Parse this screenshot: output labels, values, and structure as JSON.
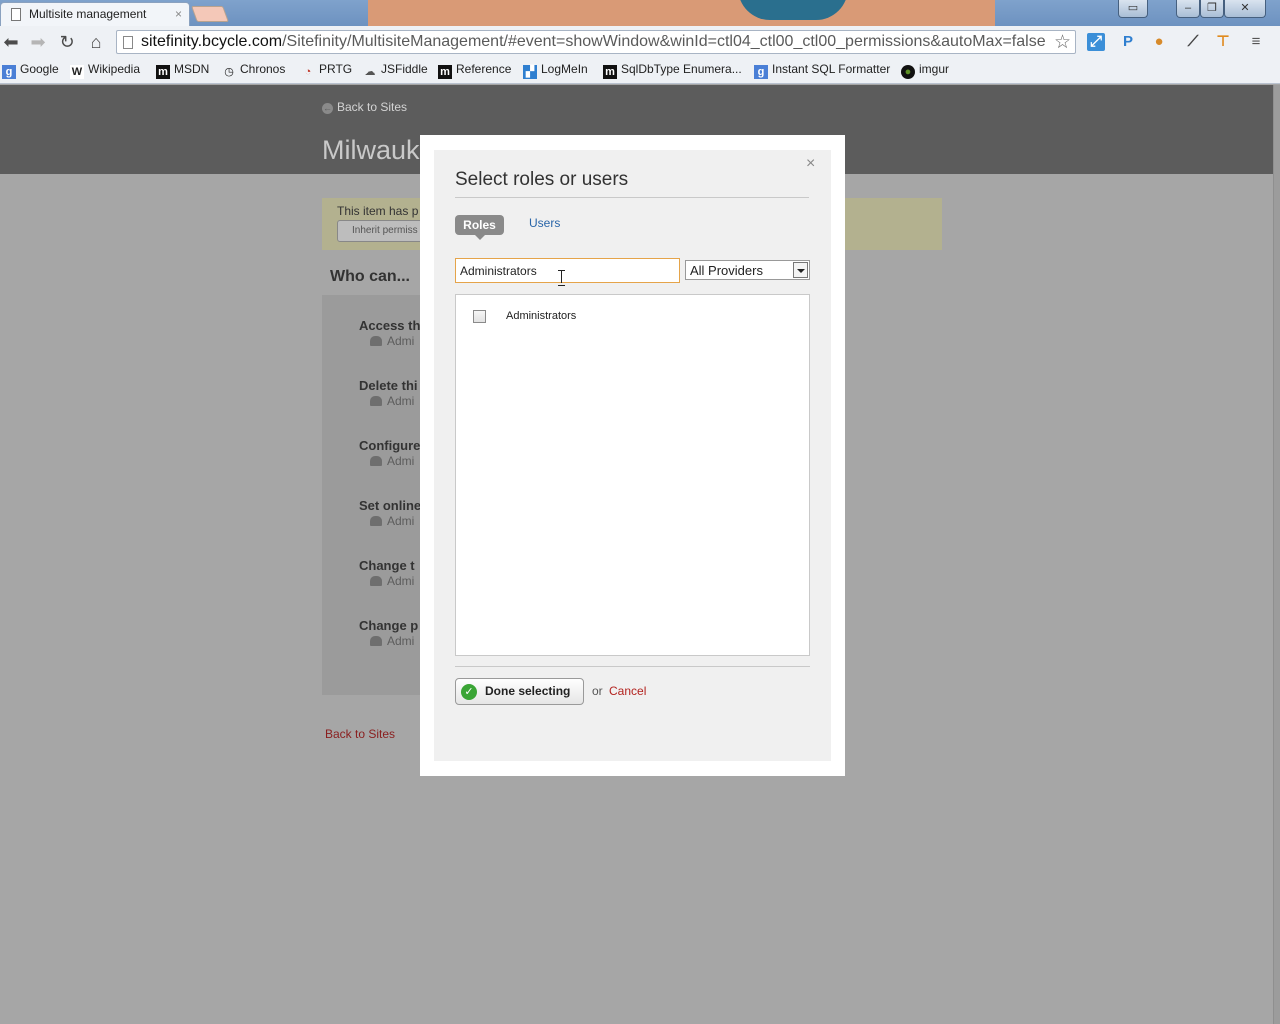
{
  "browser": {
    "tab_title": "Multisite management",
    "tab_close": "×",
    "url_host": "sitefinity.bcycle.com",
    "url_path": "/Sitefinity/MultisiteManagement/#event=showWindow&winId=ctl04_ctl00_ctl00_permissions&autoMax=false",
    "bookmarks": [
      {
        "label": "Google",
        "icon": "google-icon",
        "glyph": "g",
        "color": "#4a7fd6"
      },
      {
        "label": "Wikipedia",
        "icon": "wikipedia-icon",
        "glyph": "W",
        "color": "#222222"
      },
      {
        "label": "MSDN",
        "icon": "msdn-icon",
        "glyph": "m",
        "color": "#111111"
      },
      {
        "label": "Chronos",
        "icon": "chronos-icon",
        "glyph": "◷",
        "color": "#222222"
      },
      {
        "label": "PRTG",
        "icon": "prtg-icon",
        "glyph": "◔",
        "color": "#c0392b"
      },
      {
        "label": "JSFiddle",
        "icon": "jsfiddle-icon",
        "glyph": "☁",
        "color": "#555555"
      },
      {
        "label": "Reference",
        "icon": "reference-icon",
        "glyph": "m",
        "color": "#111111"
      },
      {
        "label": "LogMeIn",
        "icon": "logmein-icon",
        "glyph": "▞",
        "color": "#2f7fd0"
      },
      {
        "label": "SqlDbType Enumera...",
        "icon": "sqldbtype-icon",
        "glyph": "m",
        "color": "#111111"
      },
      {
        "label": "Instant SQL Formatter",
        "icon": "sql-formatter-icon",
        "glyph": "g",
        "color": "#4a7fd6"
      },
      {
        "label": "imgur",
        "icon": "imgur-icon",
        "glyph": "●",
        "color": "#5c8f24"
      }
    ]
  },
  "page": {
    "back_link_top": "Back to Sites",
    "site_title": "Milwauk",
    "notice_text": "This item has p",
    "notice_button": "Inherit permiss",
    "who_heading": "Who can...",
    "permissions": [
      {
        "label": "Access th",
        "role": "Admi"
      },
      {
        "label": "Delete thi",
        "role": "Admi"
      },
      {
        "label": "Configure",
        "role": "Admi"
      },
      {
        "label": "Set online",
        "role": "Admi"
      },
      {
        "label": "Change t",
        "role": "Admi"
      },
      {
        "label": "Change p",
        "role": "Admi"
      }
    ],
    "back_link_bottom": "Back to Sites"
  },
  "dialog": {
    "close": "×",
    "title": "Select roles or users",
    "tabs": {
      "roles": "Roles",
      "users": "Users"
    },
    "search": {
      "value": "Administrators",
      "placeholder": ""
    },
    "provider": {
      "selected": "All Providers"
    },
    "results": [
      {
        "label": "Administrators",
        "checked": false
      }
    ],
    "done_button": "Done selecting",
    "or_text": "or",
    "cancel": "Cancel"
  },
  "colors": {
    "accent_link": "#2965a8",
    "cancel_red": "#b3231f",
    "focus_orange": "#e5a44a",
    "done_green": "#3aa535"
  }
}
